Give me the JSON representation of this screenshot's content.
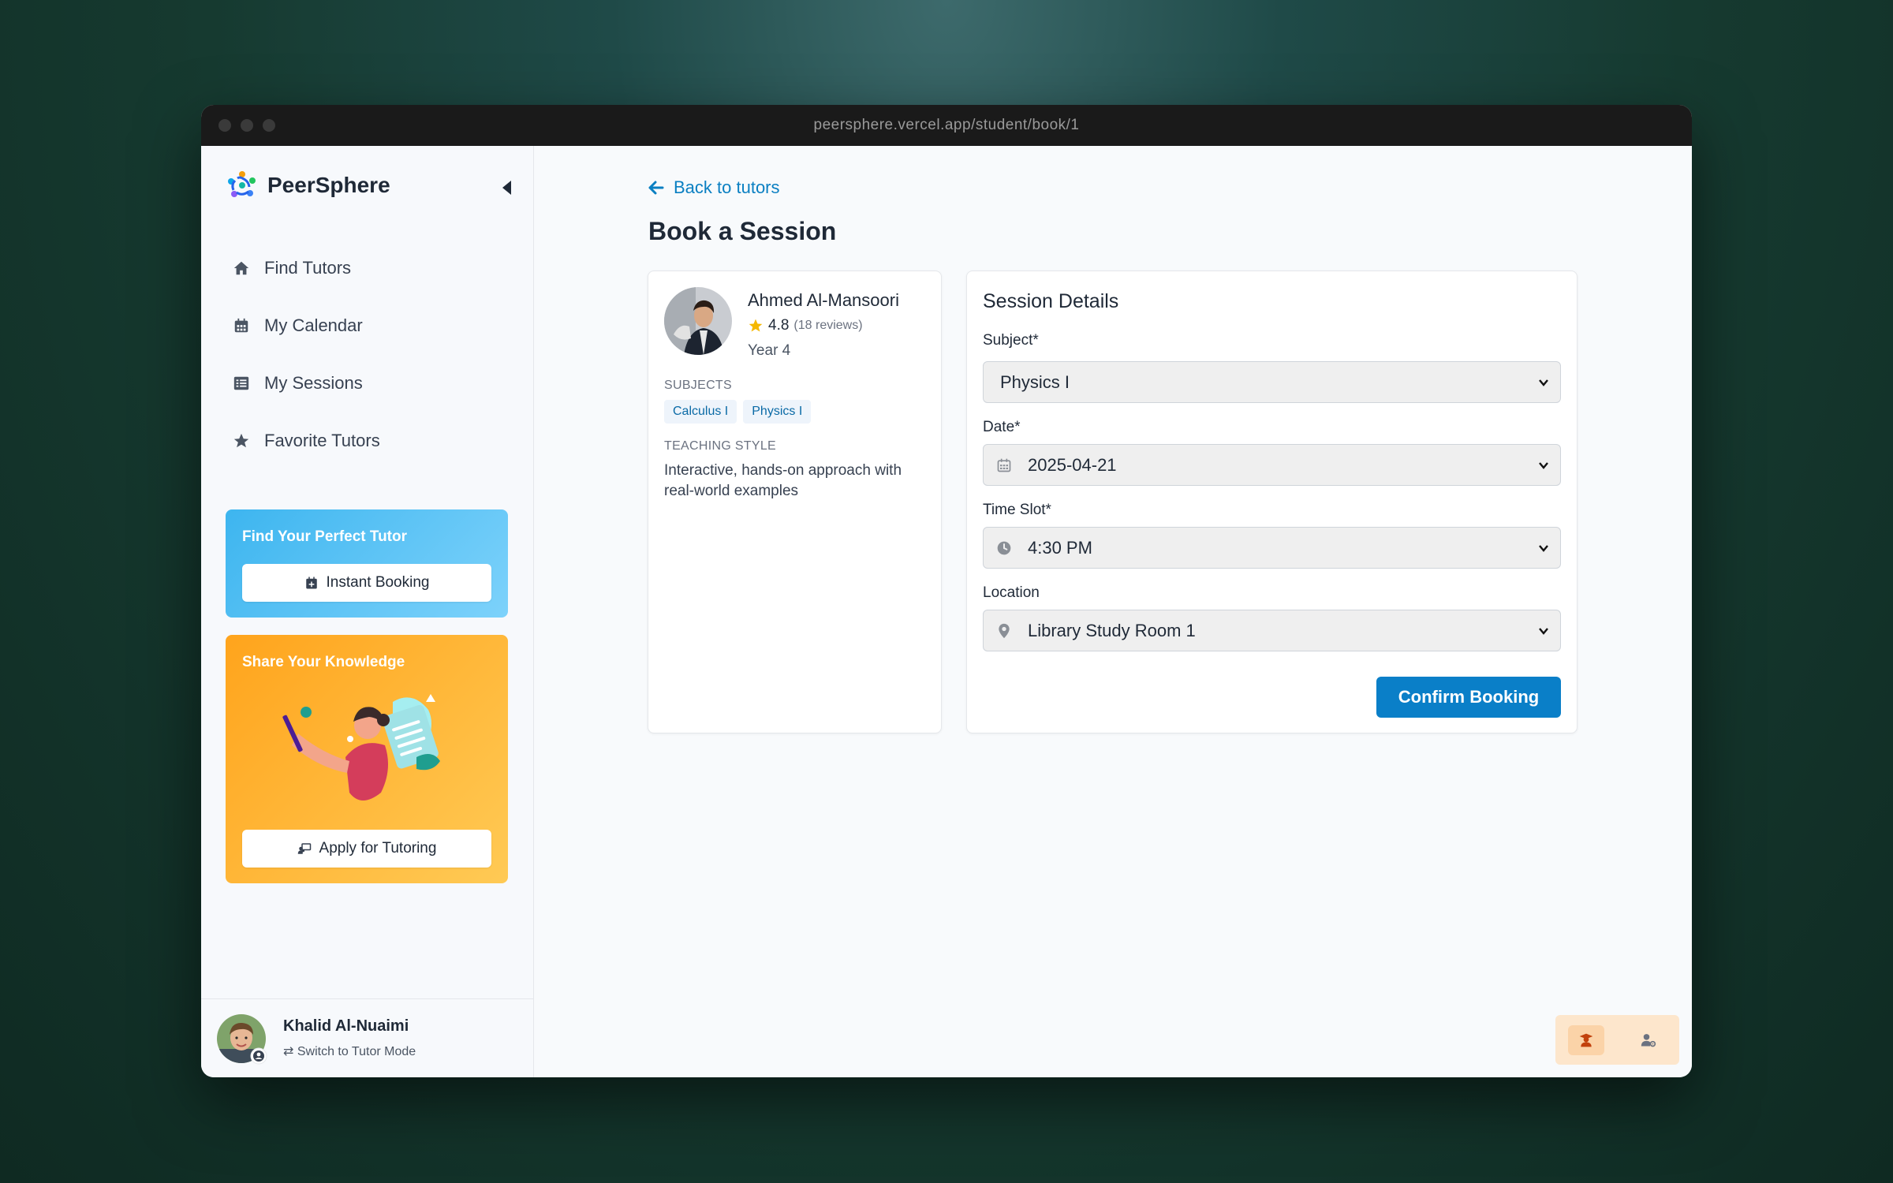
{
  "browser": {
    "url": "peersphere.vercel.app/student/book/1"
  },
  "sidebar": {
    "brand": "PeerSphere",
    "nav": [
      {
        "label": "Find Tutors",
        "icon": "home-icon"
      },
      {
        "label": "My Calendar",
        "icon": "calendar-icon"
      },
      {
        "label": "My Sessions",
        "icon": "list-icon"
      },
      {
        "label": "Favorite Tutors",
        "icon": "star-icon"
      }
    ],
    "promo_find": {
      "title": "Find Your Perfect Tutor",
      "button": "Instant Booking"
    },
    "promo_share": {
      "title": "Share Your Knowledge",
      "button": "Apply for Tutoring"
    },
    "user": {
      "name": "Khalid Al-Nuaimi",
      "switch_label": "Switch to Tutor Mode"
    }
  },
  "main": {
    "back_label": "Back to tutors",
    "title": "Book a Session",
    "tutor": {
      "name": "Ahmed Al-Mansoori",
      "rating": "4.8",
      "reviews": "(18 reviews)",
      "year": "Year 4",
      "subjects_label": "SUBJECTS",
      "subjects": [
        "Calculus I",
        "Physics I"
      ],
      "style_label": "TEACHING STYLE",
      "style_text": "Interactive, hands-on approach with real-world examples"
    },
    "session": {
      "title": "Session Details",
      "subject_label": "Subject*",
      "subject_value": "Physics I",
      "date_label": "Date*",
      "date_value": "2025-04-21",
      "time_label": "Time Slot*",
      "time_value": "4:30 PM",
      "location_label": "Location",
      "location_value": "Library Study Room 1",
      "confirm_label": "Confirm Booking"
    }
  },
  "colors": {
    "accent": "#0a7fc8",
    "promo_blue": "#3db5ef",
    "promo_orange": "#ffa41c",
    "star": "#f5b800"
  }
}
